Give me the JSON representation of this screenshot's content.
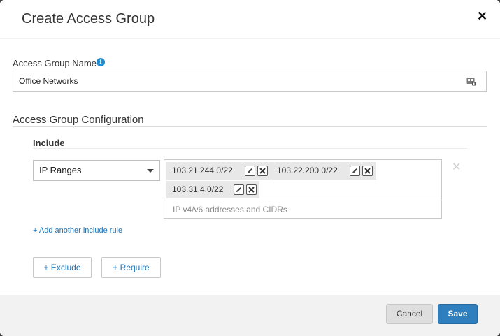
{
  "dialog": {
    "title": "Create Access Group",
    "close_glyph": "✕"
  },
  "name_field": {
    "label": "Access Group Name",
    "info_glyph": "i",
    "value": "Office Networks"
  },
  "configuration": {
    "section_title": "Access Group Configuration",
    "include_label": "Include",
    "rule_type": "IP Ranges",
    "ip_tags": [
      "103.21.244.0/22",
      "103.22.200.0/22",
      "103.31.4.0/22"
    ],
    "ip_placeholder": "IP v4/v6 addresses and CIDRs",
    "remove_glyph": "✕",
    "add_include_rule": "+ Add another include rule",
    "exclude_button": "+ Exclude",
    "require_button": "+ Require"
  },
  "footer": {
    "cancel": "Cancel",
    "save": "Save"
  },
  "colors": {
    "link": "#1f73b7",
    "primary": "#2f7fbe",
    "info": "#1f8bd0"
  }
}
